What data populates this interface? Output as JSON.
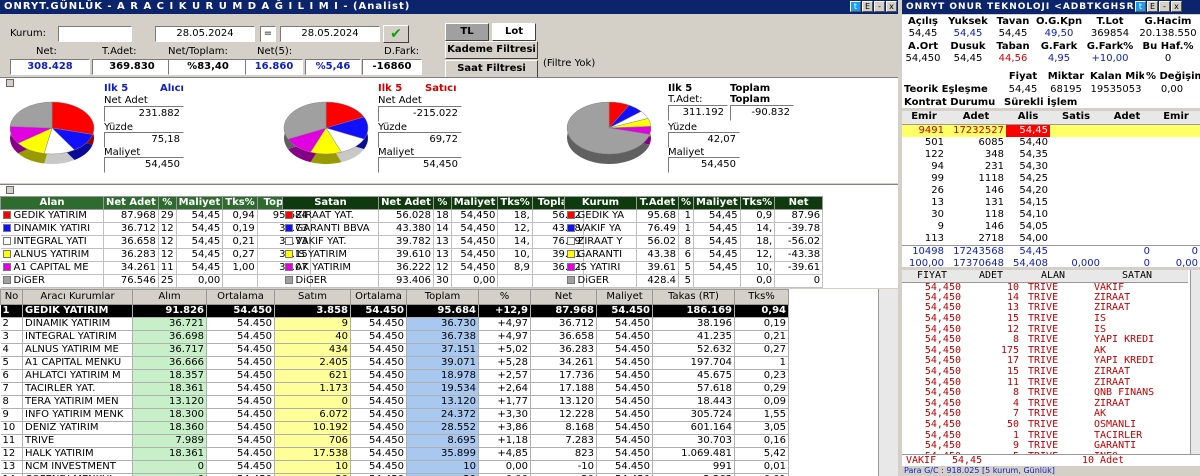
{
  "main_window": {
    "title": "ONRYT.GÜNLÜK - A R A C I  K U R U M  D A Ğ I L I M I - (Analist)",
    "kurum_label": "Kurum:",
    "date_from": "28.05.2024",
    "date_eq": "=",
    "date_to": "28.05.2024",
    "btn_tl": "TL",
    "btn_lot": "Lot",
    "btn_kademe": "Kademe Filtresi",
    "btn_saat": "Saat Filtresi",
    "filtre_yok": "(Filtre Yok)",
    "stats": [
      {
        "label": "Net:",
        "value": "308.428",
        "color": "#1020c0"
      },
      {
        "label": "T.Adet:",
        "value": "369.830",
        "color": "#000000"
      },
      {
        "label": "Net/Toplam:",
        "value": "%83,40",
        "color": "#000000"
      },
      {
        "label": "Net(5):",
        "value": "16.860",
        "color": "#1020c0"
      },
      {
        "label": "",
        "value": "%5,46",
        "color": "#1020c0"
      },
      {
        "label": "D.Fark:",
        "value": "-16860",
        "color": "#000000"
      }
    ]
  },
  "summary": {
    "buyer": {
      "ilk5": "Ilk 5",
      "role": "Alıcı",
      "net_adet_label": "Net Adet",
      "net_adet": "231.882",
      "yuzde_label": "Yüzde",
      "yuzde": "75,18",
      "maliyet_label": "Maliyet",
      "maliyet": "54,450"
    },
    "seller": {
      "ilk5": "Ilk 5",
      "role": "Satıcı",
      "net_adet_label": "Net Adet",
      "net_adet": "-215.022",
      "yuzde_label": "Yüzde",
      "yuzde": "69,72",
      "maliyet_label": "Maliyet",
      "maliyet": "54,450"
    },
    "total": {
      "ilk5": "Ilk 5",
      "toplam_label": "Toplam",
      "t_adet_label": "T.Adet:",
      "toplam_label2": "Toplam",
      "t_adet": "311.192",
      "toplam": "-90.832",
      "yuzde_label": "Yüzde",
      "yuzde": "42,07",
      "maliyet_label": "Maliyet",
      "maliyet": "54,450"
    }
  },
  "pies": {
    "buyer": [
      {
        "v": 29,
        "c": "#ff0000"
      },
      {
        "v": 12,
        "c": "#1010ff"
      },
      {
        "v": 12,
        "c": "#ffffff"
      },
      {
        "v": 12,
        "c": "#ffff00"
      },
      {
        "v": 11,
        "c": "#e000e0"
      },
      {
        "v": 24,
        "c": "#a0a0a0"
      }
    ],
    "seller": [
      {
        "v": 18,
        "c": "#ff0000"
      },
      {
        "v": 14,
        "c": "#1010ff"
      },
      {
        "v": 12,
        "c": "#ffffff"
      },
      {
        "v": 12,
        "c": "#ffff00"
      },
      {
        "v": 12,
        "c": "#e000e0"
      },
      {
        "v": 32,
        "c": "#a0a0a0"
      }
    ],
    "total": [
      {
        "v": 8,
        "c": "#ff0000"
      },
      {
        "v": 6,
        "c": "#1010ff"
      },
      {
        "v": 5,
        "c": "#ffffff"
      },
      {
        "v": 5,
        "c": "#ffff00"
      },
      {
        "v": 5,
        "c": "#e000e0"
      },
      {
        "v": 71,
        "c": "#a0a0a0"
      }
    ]
  },
  "alan_table": {
    "headers": [
      "Alan",
      "Net Adet",
      "%",
      "Maliyet",
      "Tks%",
      "Toplam"
    ],
    "rows": [
      {
        "c": "#ff0000",
        "n": "GEDIK YATIRIM",
        "a": "87.968",
        "p": "29",
        "m": "54,45",
        "t": "0,94",
        "tp": "95.684"
      },
      {
        "c": "#1010ff",
        "n": "DINAMIK YATIRI",
        "a": "36.712",
        "p": "12",
        "m": "54,45",
        "t": "0,19",
        "tp": "36.73"
      },
      {
        "c": "#ffffff",
        "n": "INTEGRAL YATI",
        "a": "36.658",
        "p": "12",
        "m": "54,45",
        "t": "0,21",
        "tp": "36.73"
      },
      {
        "c": "#ffff00",
        "n": "ALNUS YATIRIM",
        "a": "36.283",
        "p": "12",
        "m": "54,45",
        "t": "0,27",
        "tp": "37.15"
      },
      {
        "c": "#e000e0",
        "n": "A1 CAPITAL ME",
        "a": "34.261",
        "p": "11",
        "m": "54,45",
        "t": "1,00",
        "tp": "39.07"
      },
      {
        "c": "#a0a0a0",
        "n": "DiGER",
        "a": "76.546",
        "p": "25",
        "m": "0,00",
        "t": "",
        "tp": ""
      }
    ]
  },
  "satan_table": {
    "headers": [
      "Satan",
      "Net Adet",
      "%",
      "Maliyet",
      "Tks%",
      "Toplam"
    ],
    "rows": [
      {
        "c": "#ff0000",
        "n": "ZIRAAT YAT.",
        "a": "56.028",
        "p": "18",
        "m": "54,450",
        "t": "18,",
        "tp": "56.02"
      },
      {
        "c": "#1010ff",
        "n": "GARANTI BBVA",
        "a": "43.380",
        "p": "14",
        "m": "54,450",
        "t": "12,",
        "tp": "43.38"
      },
      {
        "c": "#ffffff",
        "n": "VAKIF YAT.",
        "a": "39.782",
        "p": "13",
        "m": "54,450",
        "t": "14,",
        "tp": "76.49"
      },
      {
        "c": "#ffff00",
        "n": "IS YATIRIM",
        "a": "39.610",
        "p": "13",
        "m": "54,450",
        "t": "10,",
        "tp": "39.61"
      },
      {
        "c": "#e000e0",
        "n": "AK YATIRIM",
        "a": "36.222",
        "p": "12",
        "m": "54,450",
        "t": "8,9",
        "tp": "36.22"
      },
      {
        "c": "#a0a0a0",
        "n": "DiGER",
        "a": "93.406",
        "p": "30",
        "m": "0,00",
        "t": "",
        "tp": ""
      }
    ]
  },
  "kurum_table": {
    "headers": [
      "Kurum",
      "T.Adet",
      "%",
      "Maliyet",
      "Tks%",
      "Net"
    ],
    "rows": [
      {
        "c": "#ff0000",
        "n": "GEDIK YA",
        "a": "95.68",
        "p": "1",
        "m": "54,45",
        "t": "0,9",
        "net": "87.96"
      },
      {
        "c": "#1010ff",
        "n": "VAKIF YA",
        "a": "76.49",
        "p": "1",
        "m": "54,45",
        "t": "14,",
        "net": "-39.78"
      },
      {
        "c": "#ffffff",
        "n": "ZIRAAT Y",
        "a": "56.02",
        "p": "8",
        "m": "54,45",
        "t": "18,",
        "net": "-56.02"
      },
      {
        "c": "#ffff00",
        "n": "GARANTI",
        "a": "43.38",
        "p": "6",
        "m": "54,45",
        "t": "12,",
        "net": "-43.38"
      },
      {
        "c": "#e000e0",
        "n": "IS YATIRI",
        "a": "39.61",
        "p": "5",
        "m": "54,45",
        "t": "10,",
        "net": "-39.61"
      },
      {
        "c": "#a0a0a0",
        "n": "DiGER",
        "a": "428.4",
        "p": "5",
        "m": "",
        "t": "0,0",
        "net": "0"
      }
    ]
  },
  "main_table": {
    "headers": [
      "No",
      "Aracı Kurumlar",
      "Alım",
      "Ortalama",
      "Satım",
      "Ortalama",
      "Toplam",
      "%",
      "Net",
      "Maliyet",
      "Takas (RT)",
      "Tks%"
    ],
    "rows": [
      [
        "1",
        "GEDIK YATIRIM",
        "91.826",
        "54.450",
        "3.858",
        "54.450",
        "95.684",
        "+12,9",
        "87.968",
        "54.450",
        "186.169",
        "0,94"
      ],
      [
        "2",
        "DINAMIK YATIRIM",
        "36.721",
        "54.450",
        "9",
        "54.450",
        "36.730",
        "+4,97",
        "36.712",
        "54.450",
        "38.196",
        "0,19"
      ],
      [
        "3",
        "INTEGRAL YATIRIM",
        "36.698",
        "54.450",
        "40",
        "54.450",
        "36.738",
        "+4,97",
        "36.658",
        "54.450",
        "41.235",
        "0,21"
      ],
      [
        "4",
        "ALNUS YATIRIM ME",
        "36.717",
        "54.450",
        "434",
        "54.450",
        "37.151",
        "+5,02",
        "36.283",
        "54.450",
        "52.632",
        "0,27"
      ],
      [
        "5",
        "A1 CAPITAL MENKU",
        "36.666",
        "54.450",
        "2.405",
        "54.450",
        "39.071",
        "+5,28",
        "34.261",
        "54.450",
        "197.704",
        "1"
      ],
      [
        "6",
        "AHLATCI YATIRIM M",
        "18.357",
        "54.450",
        "621",
        "54.450",
        "18.978",
        "+2,57",
        "17.736",
        "54.450",
        "45.675",
        "0,23"
      ],
      [
        "7",
        "TACIRLER YAT.",
        "18.361",
        "54.450",
        "1.173",
        "54.450",
        "19.534",
        "+2,64",
        "17.188",
        "54.450",
        "57.618",
        "0,29"
      ],
      [
        "8",
        "TERA YATIRIM MEN",
        "13.120",
        "54.450",
        "0",
        "54.450",
        "13.120",
        "+1,77",
        "13.120",
        "54.450",
        "18.443",
        "0,09"
      ],
      [
        "9",
        "INFO YATIRIM MENK",
        "18.300",
        "54.450",
        "6.072",
        "54.450",
        "24.372",
        "+3,30",
        "12.228",
        "54.450",
        "305.724",
        "1,55"
      ],
      [
        "10",
        "DENIZ YATIRIM",
        "18.360",
        "54.450",
        "10.192",
        "54.450",
        "28.552",
        "+3,86",
        "8.168",
        "54.450",
        "601.164",
        "3,05"
      ],
      [
        "11",
        "TRIVE",
        "7.989",
        "54.450",
        "706",
        "54.450",
        "8.695",
        "+1,18",
        "7.283",
        "54.450",
        "30.703",
        "0,16"
      ],
      [
        "12",
        "HALK YATIRIM",
        "18.361",
        "54.450",
        "17.538",
        "54.450",
        "35.899",
        "+4,85",
        "823",
        "54.450",
        "1.069.481",
        "5,42"
      ],
      [
        "13",
        "NCM INVESTMENT",
        "0",
        "54.450",
        "10",
        "54.450",
        "10",
        "0,00",
        "-10",
        "54.450",
        "991",
        "0,01"
      ],
      [
        "14",
        "COFENDI MENKUL",
        "0",
        "54.450",
        "20",
        "54.450",
        "20",
        "0,00",
        "-20",
        "54.450",
        "2.263",
        "0,01"
      ]
    ]
  },
  "right": {
    "title": "ONRYT   ONUR TEKNOLOJI <ADBTKGHSRE",
    "quote_headers1": [
      "Açılış",
      "Yuksek",
      "Tavan",
      "O.G.Kpn",
      "T.Lot",
      "G.Hacim"
    ],
    "quote_values1": [
      "54,45",
      "54,45",
      "54,45",
      "49,50",
      "369854",
      "20.138.550"
    ],
    "quote_headers2": [
      "A.Ort",
      "Dusuk",
      "Taban",
      "G.Fark",
      "G.Fark%",
      "Bu Haf.%"
    ],
    "quote_values2": [
      "54,450",
      "54,45",
      "44,56",
      "4,95",
      "+10,00",
      "0"
    ],
    "fiyat_headers": [
      "Fiyat",
      "Miktar",
      "Kalan Mik",
      "% Değişim"
    ],
    "teorik_label": "Teorik Eşleşme",
    "teorik_values": [
      "54,45",
      "68195",
      "19535053",
      "0,00"
    ],
    "kontrat_label": "Kontrat Durumu",
    "kontrat_value": "Sürekli İşlem",
    "depth_headers": [
      "Emir",
      "Adet",
      "Alis",
      "Satis",
      "Adet",
      "Emir"
    ],
    "depth": [
      [
        "9491",
        "17232527",
        "54,45",
        "",
        "",
        ""
      ],
      [
        "501",
        "6085",
        "54,40",
        "",
        "",
        ""
      ],
      [
        "122",
        "348",
        "54,35",
        "",
        "",
        ""
      ],
      [
        "94",
        "231",
        "54,30",
        "",
        "",
        ""
      ],
      [
        "99",
        "1118",
        "54,25",
        "",
        "",
        ""
      ],
      [
        "26",
        "146",
        "54,20",
        "",
        "",
        ""
      ],
      [
        "13",
        "131",
        "54,15",
        "",
        "",
        ""
      ],
      [
        "30",
        "118",
        "54,10",
        "",
        "",
        ""
      ],
      [
        "9",
        "146",
        "54,05",
        "",
        "",
        ""
      ],
      [
        "113",
        "2718",
        "54,00",
        "",
        "",
        ""
      ],
      [
        "10498",
        "17243568",
        "54,45",
        "",
        "0",
        "0"
      ],
      [
        "100,00",
        "17370648",
        "54,408",
        "0,000",
        "0",
        "0,00"
      ]
    ],
    "trade_headers": [
      "FIYAT",
      "ADET",
      "ALAN",
      "SATAN"
    ],
    "trades": [
      [
        "54,450",
        "10",
        "TRIVE",
        "VAKIF"
      ],
      [
        "54,450",
        "14",
        "TRIVE",
        "ZIRAAT"
      ],
      [
        "54,450",
        "13",
        "TRIVE",
        "ZIRAAT"
      ],
      [
        "54,450",
        "15",
        "TRIVE",
        "IS"
      ],
      [
        "54,450",
        "12",
        "TRIVE",
        "IS"
      ],
      [
        "54,450",
        "8",
        "TRIVE",
        "YAPI KREDI"
      ],
      [
        "54,450",
        "175",
        "TRIVE",
        "AK"
      ],
      [
        "54,450",
        "17",
        "TRIVE",
        "YAPI KREDI"
      ],
      [
        "54,450",
        "15",
        "TRIVE",
        "ZIRAAT"
      ],
      [
        "54,450",
        "11",
        "TRIVE",
        "ZIRAAT"
      ],
      [
        "54,450",
        "8",
        "TRIVE",
        "QNB FINANS"
      ],
      [
        "54,450",
        "4",
        "TRIVE",
        "ZIRAAT"
      ],
      [
        "54,450",
        "7",
        "TRIVE",
        "AK"
      ],
      [
        "54,450",
        "50",
        "TRIVE",
        "OSMANLI"
      ],
      [
        "54,450",
        "1",
        "TRIVE",
        "TACIRLER"
      ],
      [
        "54,450",
        "9",
        "TRIVE",
        "GARANTI"
      ],
      [
        "54,450",
        "5",
        "TRIVE",
        "INFO"
      ],
      [
        "54,450",
        "12",
        "TRIVE",
        "ZIRAAT"
      ],
      [
        "54,450",
        "12",
        "TRIVE",
        "AK"
      ]
    ],
    "bottom_left": "VAKIF",
    "bottom_price": "54,45",
    "bottom_adet": "10 Adet",
    "status": "Para G/C : 918.025 [5 kurum, Günlük]"
  }
}
